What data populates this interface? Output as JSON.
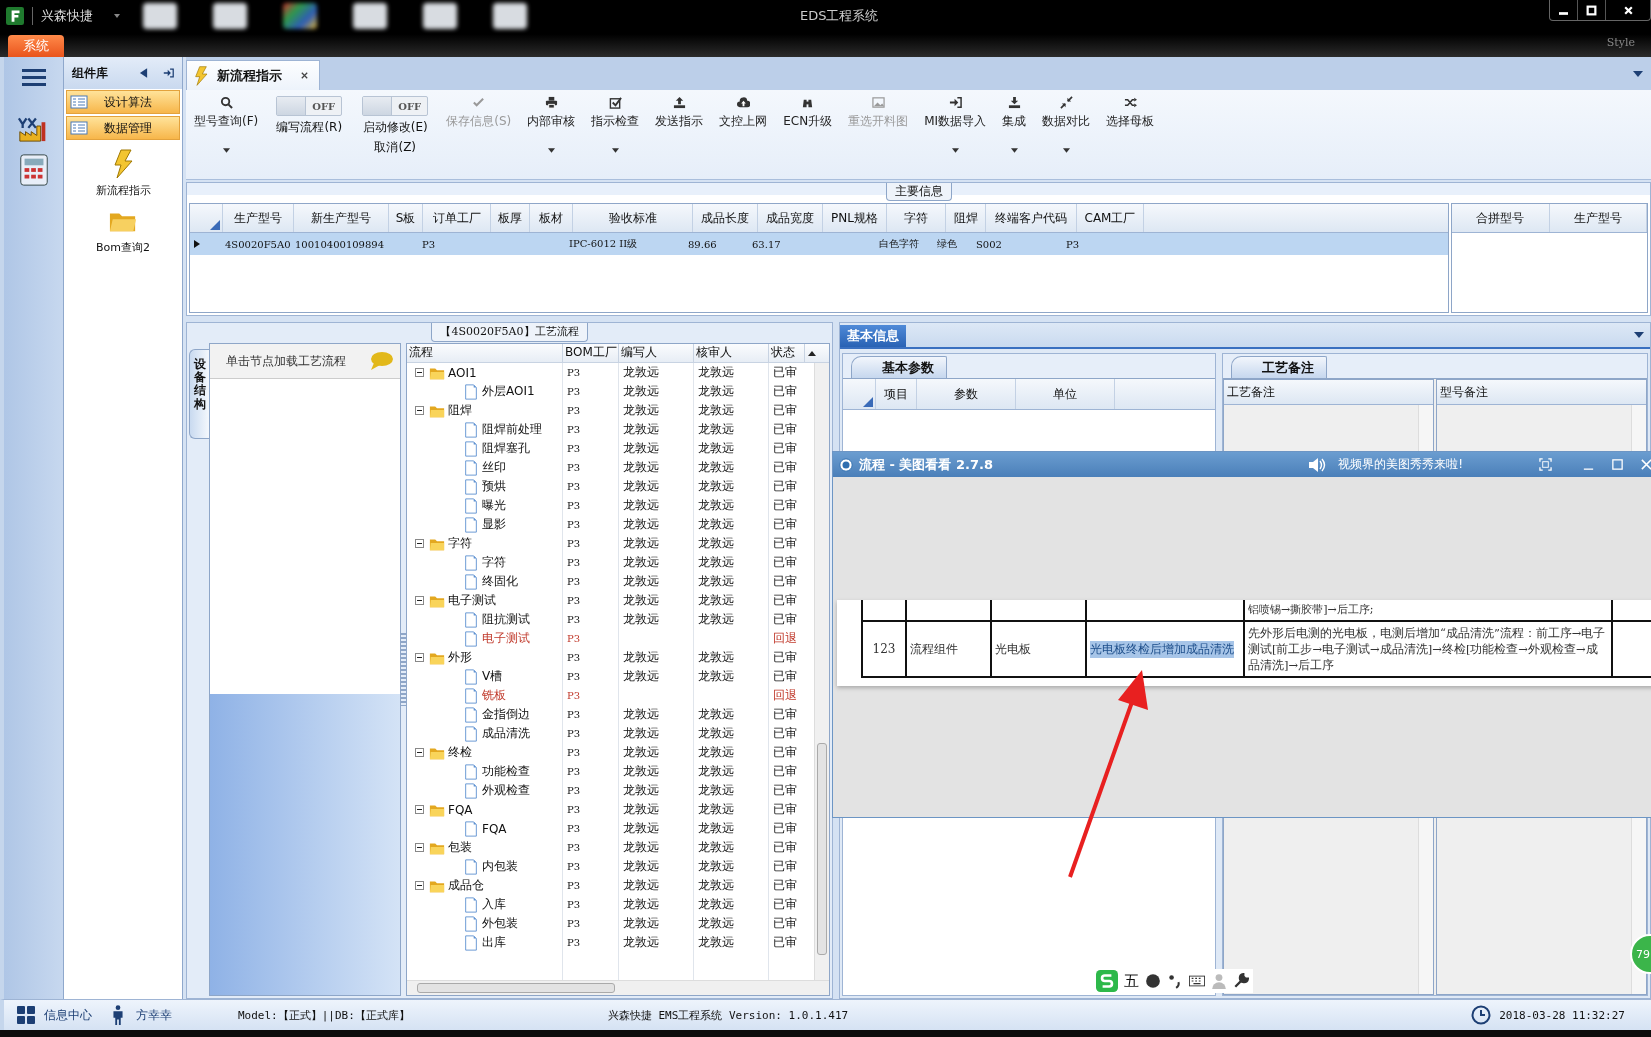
{
  "title_bar": {
    "app_name": "兴森快捷",
    "title": "EDS工程系统",
    "style_label": "Style",
    "menu_tab": "系统"
  },
  "component_panel": {
    "title": "组件库",
    "menu_items": [
      {
        "label": "设计算法"
      },
      {
        "label": "数据管理"
      }
    ],
    "shortcuts": [
      {
        "label": "新流程指示"
      },
      {
        "label": "Bom查询2"
      }
    ]
  },
  "document_tab": {
    "label": "新流程指示",
    "selected": true
  },
  "toolbar": [
    {
      "kind": "button",
      "label": "型号查询(F)",
      "disabled": false,
      "dropdown": true
    },
    {
      "kind": "toggle",
      "switch_text": "OFF",
      "on": false,
      "label": "编写流程(R)"
    },
    {
      "kind": "toggle",
      "switch_text": "OFF",
      "on": false,
      "label": "启动修改(E)",
      "sublabel": "取消(Z)"
    },
    {
      "kind": "button",
      "label": "保存信息(S)",
      "disabled": true,
      "dropdown": false
    },
    {
      "kind": "button",
      "label": "内部审核",
      "disabled": false,
      "dropdown": true
    },
    {
      "kind": "button",
      "label": "指示检查",
      "disabled": false,
      "dropdown": true
    },
    {
      "kind": "button",
      "label": "发送指示",
      "disabled": false,
      "dropdown": false
    },
    {
      "kind": "button",
      "label": "文控上网",
      "disabled": false,
      "dropdown": false
    },
    {
      "kind": "button",
      "label": "ECN升级",
      "disabled": false,
      "dropdown": false
    },
    {
      "kind": "button",
      "label": "重选开料图",
      "disabled": true,
      "dropdown": false
    },
    {
      "kind": "button",
      "label": "MI数据导入",
      "disabled": false,
      "dropdown": true
    },
    {
      "kind": "button",
      "label": "集成",
      "disabled": false,
      "dropdown": true
    },
    {
      "kind": "button",
      "label": "数据对比",
      "disabled": false,
      "dropdown": true
    },
    {
      "kind": "button",
      "label": "选择母板",
      "disabled": false,
      "dropdown": false
    }
  ],
  "main_info": {
    "title": "主要信息",
    "columns": [
      "生产型号",
      "新生产型号",
      "S板",
      "订单工厂",
      "板厚",
      "板材",
      "验收标准",
      "成品长度",
      "成品宽度",
      "PNL规格",
      "字符",
      "阻焊",
      "终端客户代码",
      "CAM工厂"
    ],
    "rows": [
      {
        "selected": true,
        "cells": [
          "4S0020F5A0",
          "10010400109894",
          null,
          "P3",
          null,
          null,
          "IPC-6012 II级",
          "89.66",
          "63.17",
          null,
          "白色字符",
          "绿色",
          "S002",
          "P3"
        ]
      }
    ],
    "side_columns": [
      "合拼型号",
      "生产型号"
    ]
  },
  "process": {
    "title": "【4S0020F5A0】工艺流程",
    "side_tab": "设备结构",
    "hint": "单击节点加载工艺流程",
    "columns": [
      "流程",
      "BOM工厂",
      "编写人",
      "核审人",
      "状态"
    ],
    "tree": [
      {
        "name": "AOI1",
        "factory": "P3",
        "writer": "龙敦远",
        "reviewer": "龙敦远",
        "status": "已审",
        "flagged": false,
        "expanded": true,
        "children": [
          {
            "name": "外层AOI1",
            "factory": "P3",
            "writer": "龙敦远",
            "reviewer": "龙敦远",
            "status": "已审",
            "flagged": false
          }
        ]
      },
      {
        "name": "阻焊",
        "factory": "P3",
        "writer": "龙敦远",
        "reviewer": "龙敦远",
        "status": "已审",
        "flagged": false,
        "expanded": true,
        "children": [
          {
            "name": "阻焊前处理",
            "factory": "P3",
            "writer": "龙敦远",
            "reviewer": "龙敦远",
            "status": "已审",
            "flagged": false
          },
          {
            "name": "阻焊塞孔",
            "factory": "P3",
            "writer": "龙敦远",
            "reviewer": "龙敦远",
            "status": "已审",
            "flagged": false
          },
          {
            "name": "丝印",
            "factory": "P3",
            "writer": "龙敦远",
            "reviewer": "龙敦远",
            "status": "已审",
            "flagged": false
          },
          {
            "name": "预烘",
            "factory": "P3",
            "writer": "龙敦远",
            "reviewer": "龙敦远",
            "status": "已审",
            "flagged": false
          },
          {
            "name": "曝光",
            "factory": "P3",
            "writer": "龙敦远",
            "reviewer": "龙敦远",
            "status": "已审",
            "flagged": false
          },
          {
            "name": "显影",
            "factory": "P3",
            "writer": "龙敦远",
            "reviewer": "龙敦远",
            "status": "已审",
            "flagged": false
          }
        ]
      },
      {
        "name": "字符",
        "factory": "P3",
        "writer": "龙敦远",
        "reviewer": "龙敦远",
        "status": "已审",
        "flagged": false,
        "expanded": true,
        "children": [
          {
            "name": "字符",
            "factory": "P3",
            "writer": "龙敦远",
            "reviewer": "龙敦远",
            "status": "已审",
            "flagged": false
          },
          {
            "name": "终固化",
            "factory": "P3",
            "writer": "龙敦远",
            "reviewer": "龙敦远",
            "status": "已审",
            "flagged": false
          }
        ]
      },
      {
        "name": "电子测试",
        "factory": "P3",
        "writer": "龙敦远",
        "reviewer": "龙敦远",
        "status": "已审",
        "flagged": false,
        "expanded": true,
        "children": [
          {
            "name": "阻抗测试",
            "factory": "P3",
            "writer": "龙敦远",
            "reviewer": "龙敦远",
            "status": "已审",
            "flagged": false
          },
          {
            "name": "电子测试",
            "factory": "P3",
            "status": "回退",
            "flagged": true
          }
        ]
      },
      {
        "name": "外形",
        "factory": "P3",
        "writer": "龙敦远",
        "reviewer": "龙敦远",
        "status": "已审",
        "flagged": false,
        "expanded": true,
        "children": [
          {
            "name": "V槽",
            "factory": "P3",
            "writer": "龙敦远",
            "reviewer": "龙敦远",
            "status": "已审",
            "flagged": false
          },
          {
            "name": "铣板",
            "factory": "P3",
            "status": "回退",
            "flagged": true
          },
          {
            "name": "金指倒边",
            "factory": "P3",
            "writer": "龙敦远",
            "reviewer": "龙敦远",
            "status": "已审",
            "flagged": false
          },
          {
            "name": "成品清洗",
            "factory": "P3",
            "writer": "龙敦远",
            "reviewer": "龙敦远",
            "status": "已审",
            "flagged": false
          }
        ]
      },
      {
        "name": "终检",
        "factory": "P3",
        "writer": "龙敦远",
        "reviewer": "龙敦远",
        "status": "已审",
        "flagged": false,
        "expanded": true,
        "children": [
          {
            "name": "功能检查",
            "factory": "P3",
            "writer": "龙敦远",
            "reviewer": "龙敦远",
            "status": "已审",
            "flagged": false
          },
          {
            "name": "外观检查",
            "factory": "P3",
            "writer": "龙敦远",
            "reviewer": "龙敦远",
            "status": "已审",
            "flagged": false
          }
        ]
      },
      {
        "name": "FQA",
        "factory": "P3",
        "writer": "龙敦远",
        "reviewer": "龙敦远",
        "status": "已审",
        "flagged": false,
        "expanded": true,
        "children": [
          {
            "name": "FQA",
            "factory": "P3",
            "writer": "龙敦远",
            "reviewer": "龙敦远",
            "status": "已审",
            "flagged": false
          }
        ]
      },
      {
        "name": "包装",
        "factory": "P3",
        "writer": "龙敦远",
        "reviewer": "龙敦远",
        "status": "已审",
        "flagged": false,
        "expanded": true,
        "children": [
          {
            "name": "内包装",
            "factory": "P3",
            "writer": "龙敦远",
            "reviewer": "龙敦远",
            "status": "已审",
            "flagged": false
          }
        ]
      },
      {
        "name": "成品仓",
        "factory": "P3",
        "writer": "龙敦远",
        "reviewer": "龙敦远",
        "status": "已审",
        "flagged": false,
        "expanded": true,
        "children": [
          {
            "name": "入库",
            "factory": "P3",
            "writer": "龙敦远",
            "reviewer": "龙敦远",
            "status": "已审",
            "flagged": false
          },
          {
            "name": "外包装",
            "factory": "P3",
            "writer": "龙敦远",
            "reviewer": "龙敦远",
            "status": "已审",
            "flagged": false
          },
          {
            "name": "出库",
            "factory": "P3",
            "writer": "龙敦远",
            "reviewer": "龙敦远",
            "status": "已审",
            "flagged": false
          }
        ]
      }
    ]
  },
  "basic_info": {
    "tab": "基本信息",
    "params_tab": "基本参数",
    "params_columns": [
      "项目",
      "参数",
      "单位"
    ],
    "notes_tab": "工艺备注",
    "notes_columns": [
      "工艺备注",
      "型号备注"
    ]
  },
  "viewer_window": {
    "title": "流程 - 美图看看 2.7.8",
    "promo": "视频界的美图秀秀来啦!",
    "prev_text": "铝喷锡→撕胶带]→后工序;",
    "cells": [
      {
        "text": "123",
        "selected": false
      },
      {
        "text": "流程组件",
        "selected": false
      },
      {
        "text": "光电板",
        "selected": false
      },
      {
        "text": "光电板终检后增加成品清洗",
        "selected": true
      },
      {
        "text": "先外形后电测的光电板，电测后增加“成品清洗”流程：前工序→电子测试[前工步→电子测试→成品清洗]→终检[功能检查→外观检查→成品清洗]→后工序",
        "selected": false
      }
    ]
  },
  "ime_bar": {
    "mode": "五"
  },
  "badge": {
    "text": "79"
  },
  "status_bar": {
    "info_center": "信息中心",
    "user": "方幸幸",
    "model": "Model:【正式】||DB:【正式库】",
    "version": "兴森快捷 EMS工程系统 Version: 1.0.1.417",
    "datetime": "2018-03-28 11:32:27"
  }
}
